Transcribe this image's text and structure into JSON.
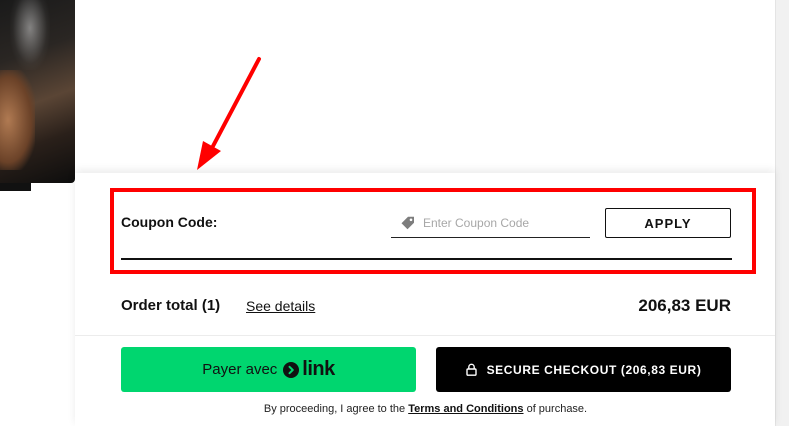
{
  "coupon": {
    "label": "Coupon Code:",
    "placeholder": "Enter Coupon Code",
    "value": "",
    "apply_label": "APPLY"
  },
  "order": {
    "total_label": "Order total (1)",
    "see_details": "See details",
    "amount": "206,83 EUR"
  },
  "payment": {
    "link_prefix": "Payer avec",
    "link_brand": "link",
    "secure_checkout_label": "SECURE CHECKOUT (206,83 EUR)"
  },
  "legal": {
    "prefix": "By proceeding, I agree to the ",
    "terms": "Terms and Conditions",
    "suffix": " of purchase."
  },
  "colors": {
    "accent_link": "#00d66f",
    "checkout": "#000000",
    "annotation": "#ff0000"
  },
  "icons": [
    "tag-icon",
    "link-chevron-icon",
    "lock-icon"
  ]
}
